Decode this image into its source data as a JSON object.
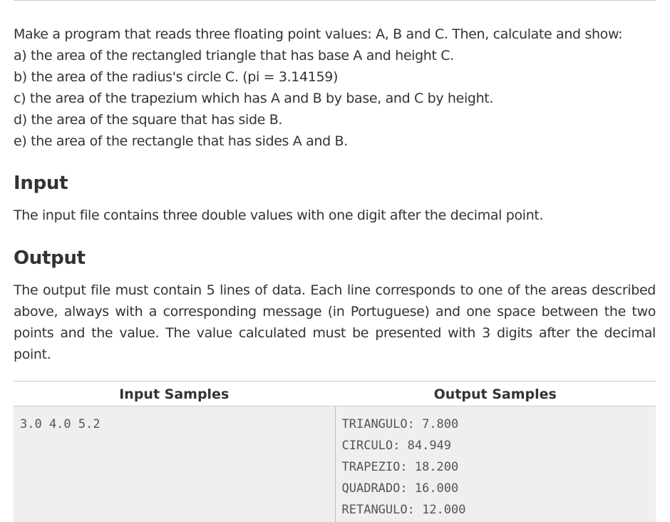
{
  "description": {
    "lines": [
      "Make a program that reads three floating point values: A, B and C. Then, calculate and show:",
      "a) the area of the rectangled triangle that has base A and height C.",
      "b) the area of the radius's circle C. (pi = 3.14159)",
      "c) the area of the trapezium which has A and B by base, and C by height.",
      "d) the area of the square that has side B.",
      "e) the area of the rectangle that has sides A and B."
    ]
  },
  "input": {
    "title": "Input",
    "text": "The input file contains three double values with one digit after the decimal point."
  },
  "output": {
    "title": "Output",
    "text": "The output file must contain 5 lines of data. Each line corresponds to one of the areas described above, always with a corresponding message (in Portuguese) and one space between the two points and the value. The value calculated must be presented with 3 digits after the decimal point."
  },
  "samples": {
    "input_header": "Input Samples",
    "output_header": "Output Samples",
    "input_lines": [
      "3.0 4.0 5.2"
    ],
    "output_lines": [
      "TRIANGULO: 7.800",
      "CIRCULO: 84.949",
      "TRAPEZIO: 18.200",
      "QUADRADO: 16.000",
      "RETANGULO: 12.000"
    ]
  }
}
